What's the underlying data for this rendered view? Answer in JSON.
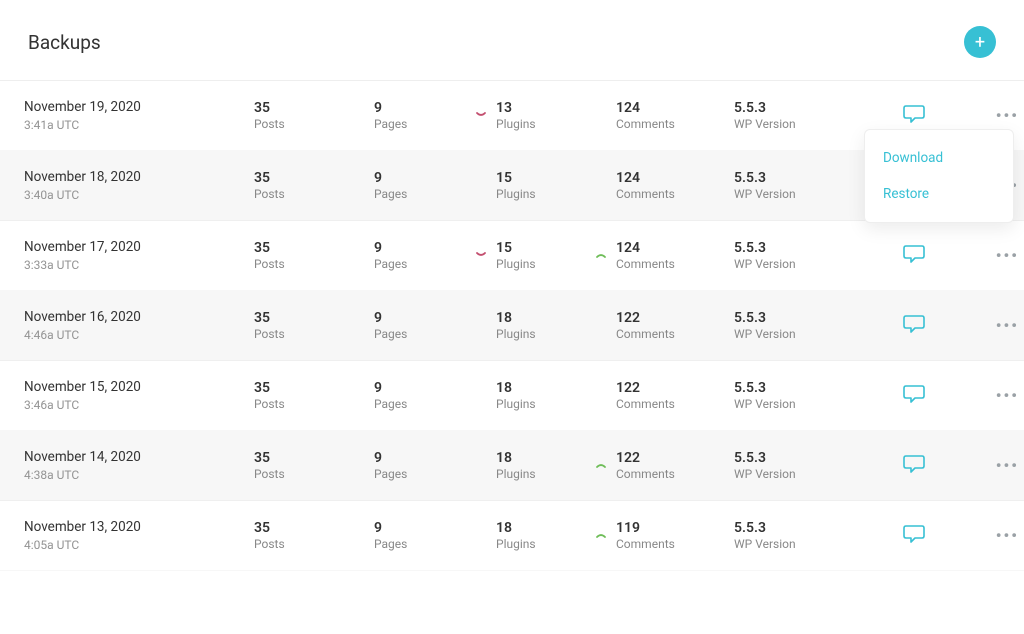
{
  "page_title": "Backups",
  "labels": {
    "posts": "Posts",
    "pages": "Pages",
    "plugins": "Plugins",
    "comments": "Comments",
    "wp": "WP Version"
  },
  "menu": {
    "download": "Download",
    "restore": "Restore"
  },
  "colors": {
    "accent": "#37c0d4",
    "up": "#6fbd59",
    "down": "#c34f6f"
  },
  "backups": [
    {
      "date": "November 19, 2020",
      "time": "3:41a UTC",
      "posts": "35",
      "pages": "9",
      "plugins": "13",
      "plugins_delta": "down",
      "comments": "124",
      "comments_delta": "",
      "wp": "5.5.3",
      "menu_open": true
    },
    {
      "date": "November 18, 2020",
      "time": "3:40a UTC",
      "posts": "35",
      "pages": "9",
      "plugins": "15",
      "plugins_delta": "",
      "comments": "124",
      "comments_delta": "",
      "wp": "5.5.3",
      "menu_open": false
    },
    {
      "date": "November 17, 2020",
      "time": "3:33a UTC",
      "posts": "35",
      "pages": "9",
      "plugins": "15",
      "plugins_delta": "down",
      "comments": "124",
      "comments_delta": "up",
      "wp": "5.5.3",
      "menu_open": false
    },
    {
      "date": "November 16, 2020",
      "time": "4:46a UTC",
      "posts": "35",
      "pages": "9",
      "plugins": "18",
      "plugins_delta": "",
      "comments": "122",
      "comments_delta": "",
      "wp": "5.5.3",
      "menu_open": false
    },
    {
      "date": "November 15, 2020",
      "time": "3:46a UTC",
      "posts": "35",
      "pages": "9",
      "plugins": "18",
      "plugins_delta": "",
      "comments": "122",
      "comments_delta": "",
      "wp": "5.5.3",
      "menu_open": false
    },
    {
      "date": "November 14, 2020",
      "time": "4:38a UTC",
      "posts": "35",
      "pages": "9",
      "plugins": "18",
      "plugins_delta": "",
      "comments": "122",
      "comments_delta": "up",
      "wp": "5.5.3",
      "menu_open": false
    },
    {
      "date": "November 13, 2020",
      "time": "4:05a UTC",
      "posts": "35",
      "pages": "9",
      "plugins": "18",
      "plugins_delta": "",
      "comments": "119",
      "comments_delta": "up",
      "wp": "5.5.3",
      "menu_open": false
    }
  ]
}
